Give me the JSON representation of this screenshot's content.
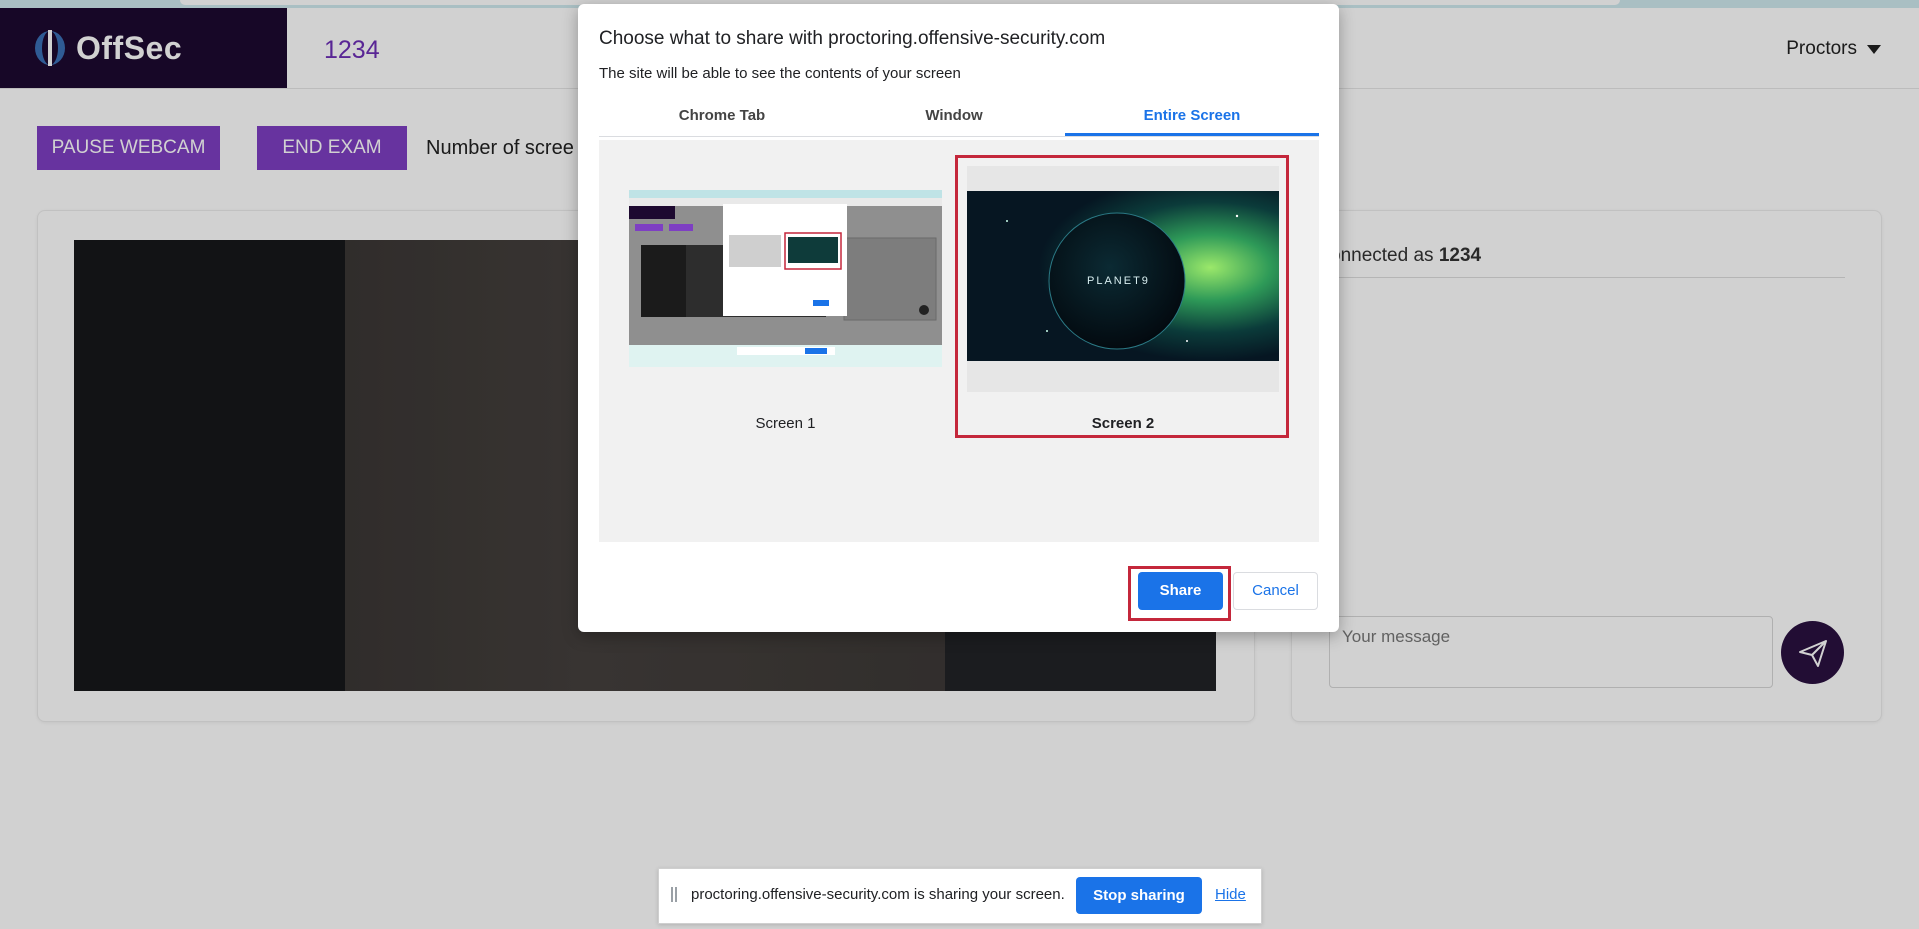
{
  "app": {
    "brand": "OffSec",
    "exam_id": "1234",
    "proctors_label": "Proctors"
  },
  "toolbar": {
    "pause_label": "PAUSE WEBCAM",
    "end_label": "END EXAM",
    "screens_label": "Number of scree"
  },
  "chat": {
    "connected_prefix": "onnected as ",
    "connected_user": "1234",
    "message_placeholder": "Your message"
  },
  "share_dialog": {
    "title": "Choose what to share with proctoring.offensive-security.com",
    "subtitle": "The site will be able to see the contents of your screen",
    "tabs": [
      "Chrome Tab",
      "Window",
      "Entire Screen"
    ],
    "active_tab": "Entire Screen",
    "screens": [
      {
        "label": "Screen 1",
        "selected": false
      },
      {
        "label": "Screen 2",
        "selected": true
      }
    ],
    "thumbnail_logo_text": "PLANET9",
    "share_label": "Share",
    "cancel_label": "Cancel"
  },
  "sharing_bar": {
    "message": "proctoring.offensive-security.com is sharing your screen.",
    "stop_label": "Stop sharing",
    "hide_label": "Hide"
  },
  "colors": {
    "brand_purple": "#7e3fc3",
    "brand_dark": "#1d0930",
    "chrome_blue": "#1a73e8",
    "highlight_red": "#c4273b"
  }
}
